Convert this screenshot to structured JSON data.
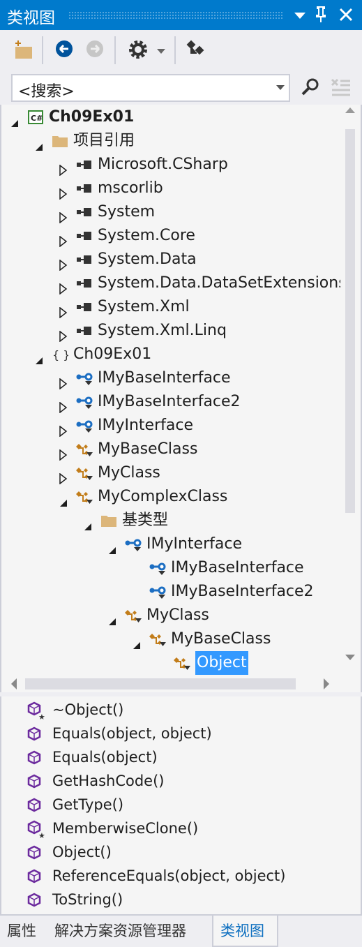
{
  "window": {
    "title": "类视图",
    "controls": [
      "dropdown-icon",
      "pin-icon",
      "close-icon"
    ]
  },
  "toolbar": {
    "buttons": [
      "new-folder-icon",
      "back-icon",
      "forward-icon",
      "settings-icon",
      "settings-dropdown-icon",
      "sync-icon"
    ]
  },
  "search": {
    "placeholder": "<搜索>",
    "value": "<搜索>"
  },
  "tree": [
    {
      "label": "Ch09Ex01",
      "level": 0,
      "expander": "open",
      "icon": "csharp-project-icon",
      "bold": true
    },
    {
      "label": "项目引用",
      "level": 1,
      "expander": "open",
      "icon": "folder-icon"
    },
    {
      "label": "Microsoft.CSharp",
      "level": 2,
      "expander": "closed",
      "icon": "reference-icon"
    },
    {
      "label": "mscorlib",
      "level": 2,
      "expander": "closed",
      "icon": "reference-icon"
    },
    {
      "label": "System",
      "level": 2,
      "expander": "closed",
      "icon": "reference-icon"
    },
    {
      "label": "System.Core",
      "level": 2,
      "expander": "closed",
      "icon": "reference-icon"
    },
    {
      "label": "System.Data",
      "level": 2,
      "expander": "closed",
      "icon": "reference-icon"
    },
    {
      "label": "System.Data.DataSetExtensions",
      "level": 2,
      "expander": "closed",
      "icon": "reference-icon"
    },
    {
      "label": "System.Xml",
      "level": 2,
      "expander": "closed",
      "icon": "reference-icon"
    },
    {
      "label": "System.Xml.Linq",
      "level": 2,
      "expander": "closed",
      "icon": "reference-icon"
    },
    {
      "label": "Ch09Ex01",
      "level": 1,
      "expander": "open",
      "icon": "namespace-icon"
    },
    {
      "label": "IMyBaseInterface",
      "level": 2,
      "expander": "closed",
      "icon": "interface-icon"
    },
    {
      "label": "IMyBaseInterface2",
      "level": 2,
      "expander": "closed",
      "icon": "interface-icon"
    },
    {
      "label": "IMyInterface",
      "level": 2,
      "expander": "closed",
      "icon": "interface-icon"
    },
    {
      "label": "MyBaseClass",
      "level": 2,
      "expander": "closed",
      "icon": "class-icon"
    },
    {
      "label": "MyClass",
      "level": 2,
      "expander": "closed",
      "icon": "class-icon"
    },
    {
      "label": "MyComplexClass",
      "level": 2,
      "expander": "open",
      "icon": "class-icon"
    },
    {
      "label": "基类型",
      "level": 3,
      "expander": "open",
      "icon": "folder-icon"
    },
    {
      "label": "IMyInterface",
      "level": 4,
      "expander": "open",
      "icon": "interface-icon"
    },
    {
      "label": "IMyBaseInterface",
      "level": 5,
      "expander": "none",
      "icon": "interface-icon"
    },
    {
      "label": "IMyBaseInterface2",
      "level": 5,
      "expander": "none",
      "icon": "interface-icon"
    },
    {
      "label": "MyClass",
      "level": 4,
      "expander": "open",
      "icon": "class-icon"
    },
    {
      "label": "MyBaseClass",
      "level": 5,
      "expander": "open",
      "icon": "class-icon"
    },
    {
      "label": "Object",
      "level": 6,
      "expander": "none",
      "icon": "class-icon",
      "selected": true
    }
  ],
  "members": [
    {
      "label": "~Object()",
      "icon": "protected-method-icon"
    },
    {
      "label": "Equals(object, object)",
      "icon": "method-icon"
    },
    {
      "label": "Equals(object)",
      "icon": "method-icon"
    },
    {
      "label": "GetHashCode()",
      "icon": "method-icon"
    },
    {
      "label": "GetType()",
      "icon": "method-icon"
    },
    {
      "label": "MemberwiseClone()",
      "icon": "protected-method-icon"
    },
    {
      "label": "Object()",
      "icon": "method-icon"
    },
    {
      "label": "ReferenceEquals(object, object)",
      "icon": "method-icon"
    },
    {
      "label": "ToString()",
      "icon": "method-icon"
    }
  ],
  "tabs": [
    {
      "label": "属性"
    },
    {
      "label": "解决方案资源管理器"
    },
    {
      "label": "类视图",
      "active": true
    }
  ],
  "colors": {
    "accent": "#007acc",
    "selection": "#3399ff",
    "class": "#c27d1a",
    "interface": "#1c6ec2",
    "method": "#6c2b9e"
  }
}
